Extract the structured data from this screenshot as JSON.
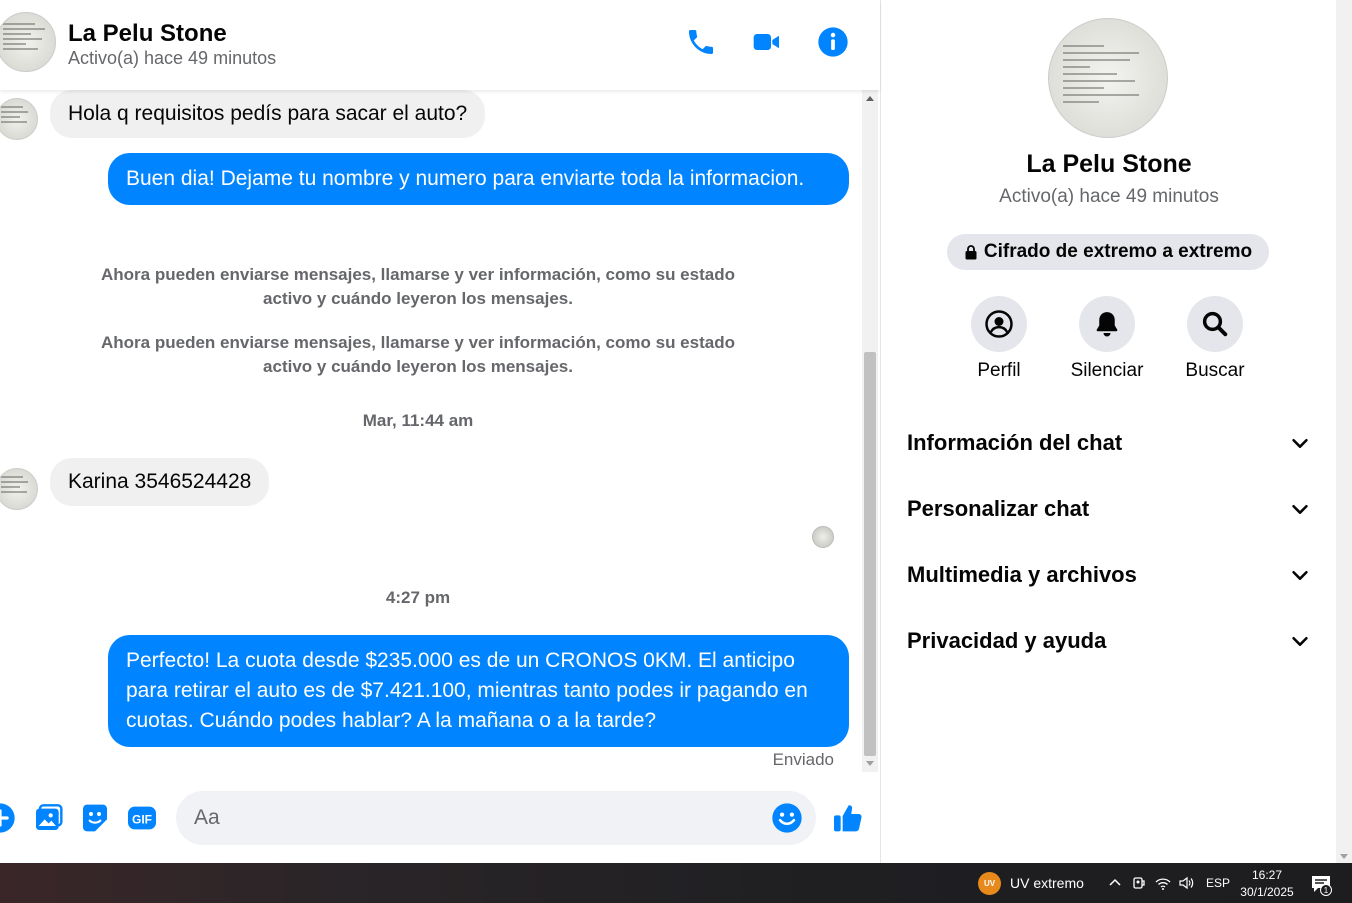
{
  "header": {
    "contact_name": "La Pelu Stone",
    "status": "Activo(a) hace 49 minutos",
    "icons": [
      "phone-icon",
      "video-camera-icon",
      "info-icon"
    ]
  },
  "messages": {
    "msg1": {
      "direction": "incoming",
      "text": "Hola q requisitos pedís para sacar el auto?"
    },
    "msg2": {
      "direction": "outgoing",
      "text": "Buen dia! Dejame tu nombre y numero para enviarte toda la informacion."
    },
    "note1": "Ahora pueden enviarse mensajes, llamarse y ver información, como su estado activo y cuándo leyeron los mensajes.",
    "note2": "Ahora pueden enviarse mensajes, llamarse y ver información, como su estado activo y cuándo leyeron los mensajes.",
    "time1": "Mar, 11:44 am",
    "msg3": {
      "direction": "incoming",
      "text": "Karina 3546524428"
    },
    "time2": "4:27 pm",
    "msg4": {
      "direction": "outgoing",
      "text": "Perfecto! La cuota desde $235.000 es de un CRONOS 0KM. El anticipo para retirar el auto es de $7.421.100, mientras tanto podes ir pagando en cuotas. Cuándo podes hablar? A la mañana o a la tarde?"
    },
    "sent_status": "Enviado"
  },
  "composer": {
    "placeholder": "Aa",
    "icons": [
      "plus-icon",
      "image-icon",
      "sticker-icon",
      "gif-icon",
      "emoji-icon",
      "thumbs-up-icon"
    ],
    "gif_label": "GIF"
  },
  "details": {
    "name": "La Pelu Stone",
    "status": "Activo(a) hace 49 minutos",
    "encryption": "Cifrado de extremo a extremo",
    "actions": [
      {
        "label": "Perfil",
        "icon": "profile-icon"
      },
      {
        "label": "Silenciar",
        "icon": "bell-icon"
      },
      {
        "label": "Buscar",
        "icon": "search-icon"
      }
    ],
    "sections": [
      {
        "label": "Información del chat"
      },
      {
        "label": "Personalizar chat"
      },
      {
        "label": "Multimedia y archivos"
      },
      {
        "label": "Privacidad y ayuda"
      }
    ]
  },
  "taskbar": {
    "uv_badge": "UV",
    "weather": "UV extremo",
    "language": "ESP",
    "time": "16:27",
    "date": "30/1/2025",
    "notification_count": "1"
  },
  "colors": {
    "accent": "#0084ff",
    "incoming_bubble": "#f0f0f0",
    "muted_text": "#65676b"
  }
}
